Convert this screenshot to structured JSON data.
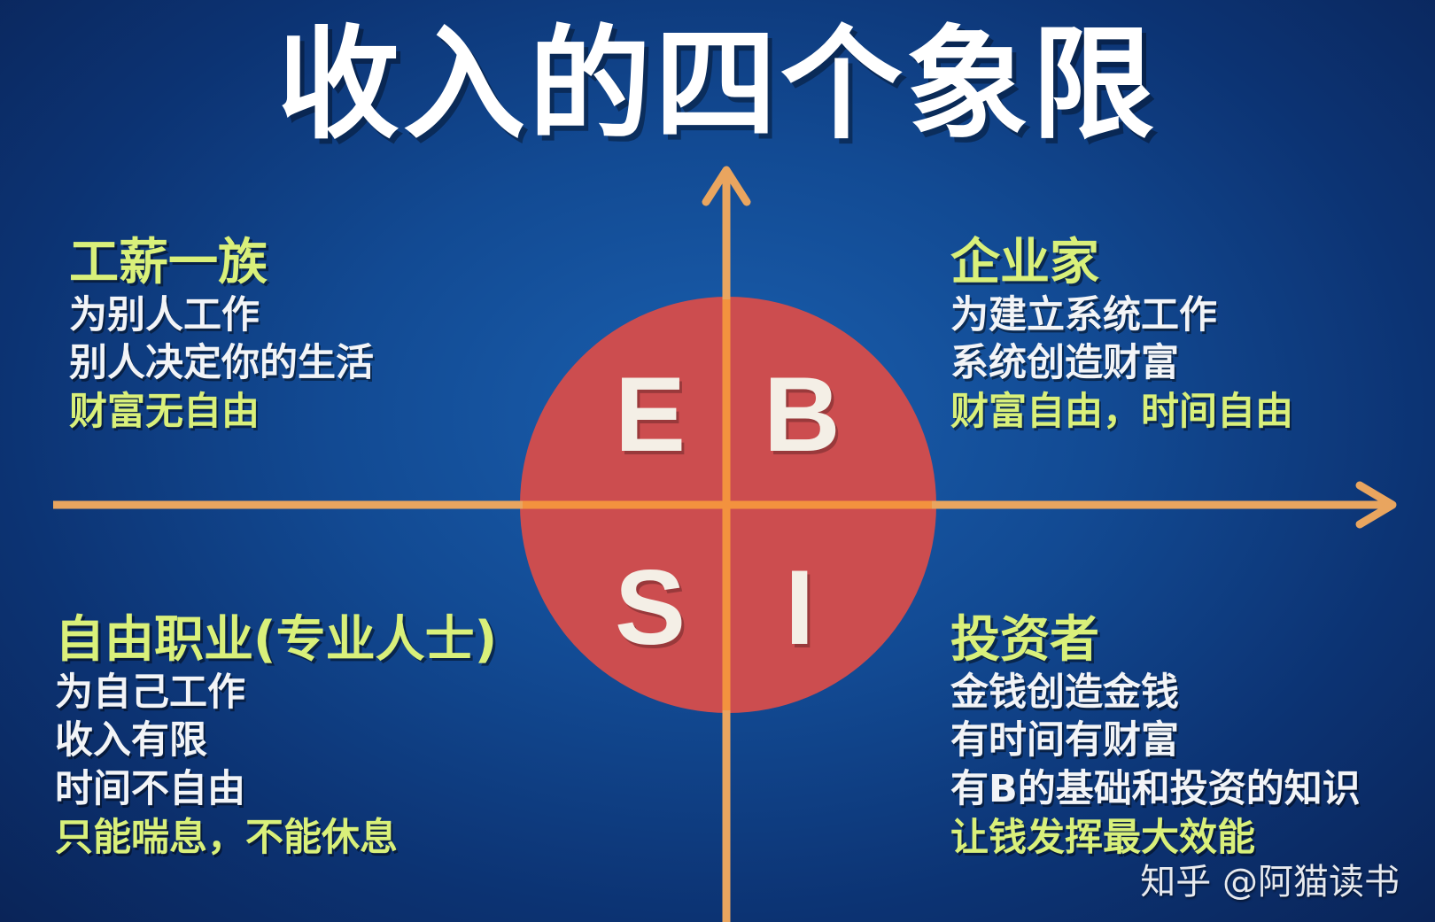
{
  "title": "收入的四个象限",
  "letters": {
    "E": "E",
    "B": "B",
    "S": "S",
    "I": "I"
  },
  "quadrants": {
    "top_left": {
      "head": "工薪一族",
      "lines": [
        "为别人工作",
        "别人决定你的生活",
        "财富无自由"
      ]
    },
    "top_right": {
      "head": "企业家",
      "lines": [
        "为建立系统工作",
        "系统创造财富",
        "财富自由，时间自由"
      ]
    },
    "bottom_left": {
      "head": "自由职业(专业人士)",
      "lines": [
        "为自己工作",
        "收入有限",
        "时间不自由",
        "只能喘息，不能休息"
      ]
    },
    "bottom_right": {
      "head": "投资者",
      "lines": [
        "金钱创造金钱",
        "有时间有财富",
        "有B的基础和投资的知识",
        "让钱发挥最大效能"
      ]
    }
  },
  "watermark": "知乎 @阿猫读书",
  "colors": {
    "background": "#124a93",
    "circle": "#cc4d4f",
    "axis": "#e9a55f",
    "highlight_text": "#d9f07a",
    "body_text": "#f2f4f7"
  }
}
